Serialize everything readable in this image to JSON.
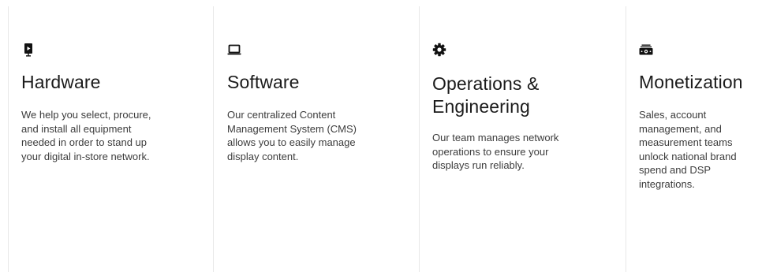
{
  "columns": [
    {
      "icon": "digital-signage-icon",
      "title": "Hardware",
      "description": "We help you select, procure, and install all equipment needed in order to stand up your digital in-store network."
    },
    {
      "icon": "laptop-icon",
      "title": "Software",
      "description": "Our centralized Content Management System (CMS) allows you to easily manage display content."
    },
    {
      "icon": "gear-icon",
      "title_line1": "Operations &",
      "title_line2": "Engineering",
      "description": "Our team manages network operations to ensure your displays run reliably."
    },
    {
      "icon": "money-icon",
      "title": "Monetization",
      "description": "Sales, account management, and measurement teams unlock national brand spend and DSP integrations."
    }
  ]
}
